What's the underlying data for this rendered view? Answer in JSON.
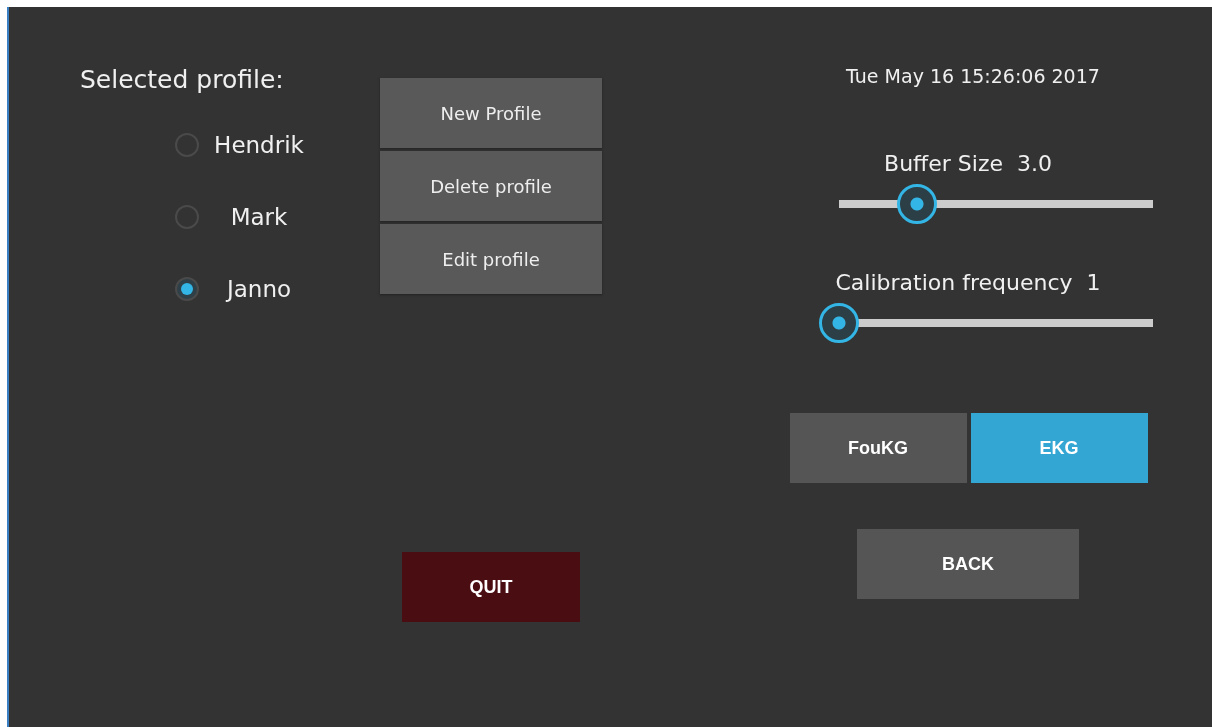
{
  "profile_label": "Selected profile:",
  "profiles": [
    {
      "name": "Hendrik",
      "selected": false
    },
    {
      "name": "Mark",
      "selected": false
    },
    {
      "name": "Janno",
      "selected": true
    }
  ],
  "profile_buttons": [
    "New Profile",
    "Delete profile",
    "Edit profile"
  ],
  "quit_button": "QUIT",
  "datetime": "Tue May 16 15:26:06 2017",
  "sliders": [
    {
      "label": "Buffer Size",
      "reading": "3.0",
      "level": 0.25
    },
    {
      "label": "Calibration frequency",
      "reading": "1",
      "level": 0
    }
  ],
  "modes": [
    {
      "label": "FouKG",
      "selected": false
    },
    {
      "label": "EKG",
      "selected": true
    }
  ],
  "back_button": "BACK"
}
